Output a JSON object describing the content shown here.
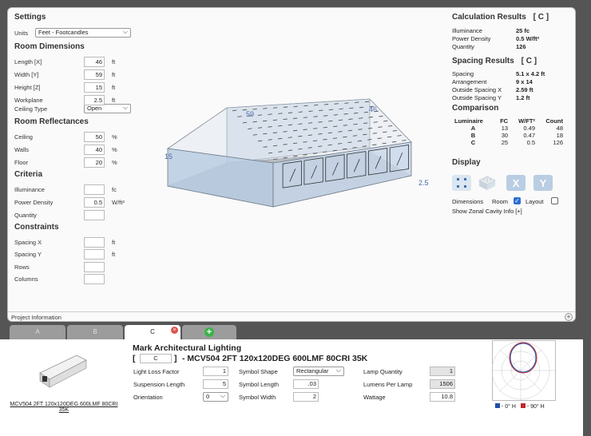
{
  "settings": {
    "title": "Settings",
    "units_label": "Units",
    "units_value": "Feet - Footcandles"
  },
  "room_dimensions": {
    "title": "Room Dimensions",
    "rows": [
      {
        "label": "Length [X]",
        "value": "46",
        "unit": "ft"
      },
      {
        "label": "Width [Y]",
        "value": "59",
        "unit": "ft"
      },
      {
        "label": "Height [Z]",
        "value": "15",
        "unit": "ft"
      },
      {
        "label": "Workplane",
        "value": "2.5",
        "unit": "ft"
      }
    ],
    "ceiling_type_label": "Ceiling Type",
    "ceiling_type_value": "Open"
  },
  "room_reflectances": {
    "title": "Room Reflectances",
    "rows": [
      {
        "label": "Ceiling",
        "value": "50",
        "unit": "%"
      },
      {
        "label": "Walls",
        "value": "40",
        "unit": "%"
      },
      {
        "label": "Floor",
        "value": "20",
        "unit": "%"
      }
    ]
  },
  "criteria": {
    "title": "Criteria",
    "rows": [
      {
        "label": "Illuminance",
        "value": "",
        "unit": "fc"
      },
      {
        "label": "Power Density",
        "value": "0.5",
        "unit": "W/ft²"
      },
      {
        "label": "Quantity",
        "value": "",
        "unit": ""
      }
    ]
  },
  "constraints": {
    "title": "Constraints",
    "rows": [
      {
        "label": "Spacing X",
        "value": "",
        "unit": "ft"
      },
      {
        "label": "Spacing Y",
        "value": "",
        "unit": "ft"
      },
      {
        "label": "Rows",
        "value": "",
        "unit": ""
      },
      {
        "label": "Columns",
        "value": "",
        "unit": ""
      }
    ]
  },
  "viewport": {
    "dim_width": "59",
    "dim_length": "46",
    "dim_height": "15",
    "dim_workplane": "2.5"
  },
  "calc_results": {
    "title": "Calculation Results",
    "tag": "[ C ]",
    "rows": [
      {
        "label": "Illuminance",
        "value": "25  fc"
      },
      {
        "label": "Power Density",
        "value": "0.5  W/ft²"
      },
      {
        "label": "Quantity",
        "value": "126"
      }
    ]
  },
  "spacing_results": {
    "title": "Spacing Results",
    "tag": "[ C ]",
    "rows": [
      {
        "label": "Spacing",
        "value": "5.1 x 4.2  ft"
      },
      {
        "label": "Arrangement",
        "value": "9 x 14"
      },
      {
        "label": "Outside Spacing X",
        "value": "2.59  ft"
      },
      {
        "label": "Outside Spacing Y",
        "value": "1.2  ft"
      }
    ]
  },
  "comparison": {
    "title": "Comparison",
    "headers": [
      "Luminaire",
      "FC",
      "W/FT²",
      "Count"
    ],
    "rows": [
      [
        "A",
        "13",
        "0.49",
        "48"
      ],
      [
        "B",
        "30",
        "0.47",
        "18"
      ],
      [
        "C",
        "25",
        "0.5",
        "126"
      ]
    ]
  },
  "display": {
    "title": "Display",
    "dimensions_label": "Dimensions",
    "room_label": "Room",
    "layout_label": "Layout",
    "zonal_label": "Show Zonal Cavity Info [+]"
  },
  "project_info": "Project Information",
  "tabs": [
    "A",
    "B",
    "C"
  ],
  "luminaire": {
    "manufacturer": "Mark Architectural Lighting",
    "bracket_open": "[",
    "code": "C",
    "bracket_close": "]",
    "name": "- MCV504 2FT 120x120DEG 600LMF 80CRI 35K",
    "thumb_caption_1": "MCV504 2FT 120x120DEG 600LMF 80CRI",
    "thumb_caption_2": "35K",
    "llf_label": "Light Loss Factor",
    "llf_value": "1",
    "suspension_label": "Suspension Length",
    "suspension_value": "5",
    "orientation_label": "Orientation",
    "orientation_value": "0",
    "symbol_shape_label": "Symbol Shape",
    "symbol_shape_value": "Rectangular",
    "symbol_length_label": "Symbol Length",
    "symbol_length_value": ".03",
    "symbol_width_label": "Symbol Width",
    "symbol_width_value": "2",
    "lamp_qty_label": "Lamp Quantity",
    "lamp_qty_value": "1",
    "lumens_label": "Lumens Per Lamp",
    "lumens_value": "1506",
    "wattage_label": "Wattage",
    "wattage_value": "10.8",
    "legend_0": "- 0° H",
    "legend_90": "- 90° H"
  },
  "colors": {
    "accent_blue": "#1f4fa8",
    "accent_red": "#c0282d",
    "tab_add_green": "#3bb34a",
    "tab_close_red": "#d9574a"
  }
}
